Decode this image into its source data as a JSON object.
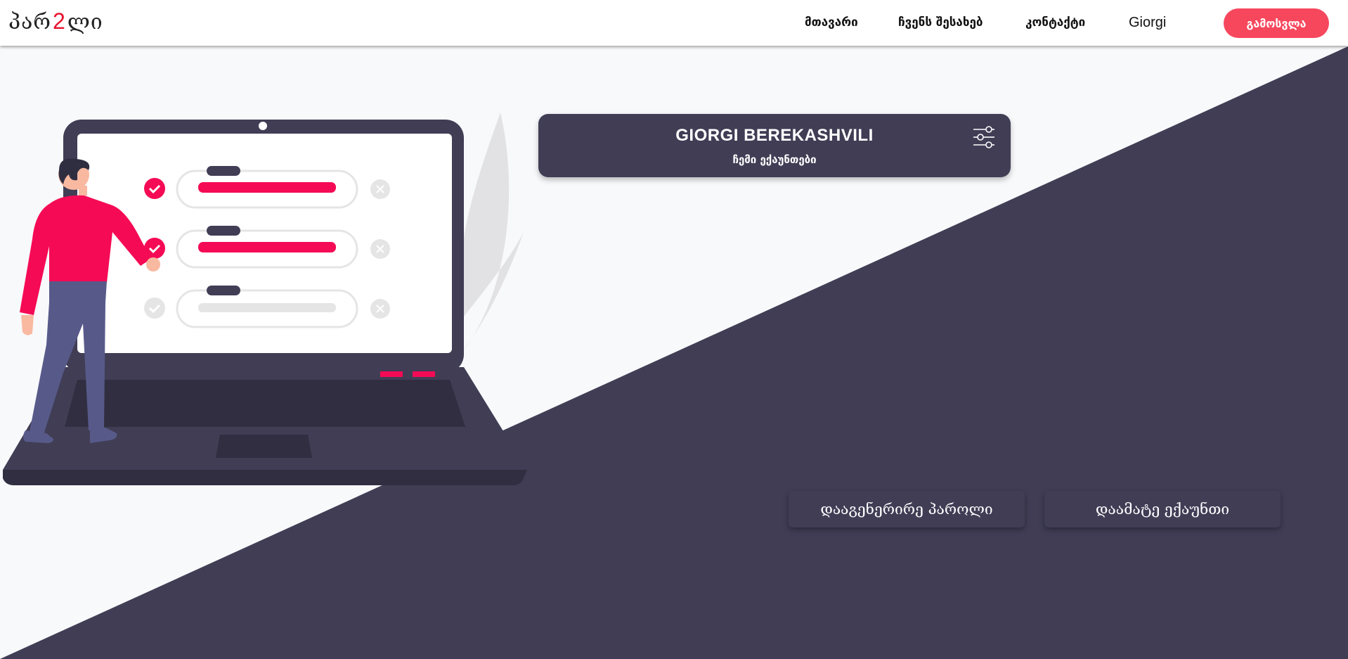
{
  "brand": {
    "logo_prefix": "პარ",
    "logo_number": "2",
    "logo_suffix": "ლი"
  },
  "nav": {
    "links": [
      {
        "label": "მთავარი"
      },
      {
        "label": "ჩვენს შესახებ"
      },
      {
        "label": "კონტაქტი"
      },
      {
        "label": "Giorgi"
      }
    ],
    "logout_label": "გამოსვლა"
  },
  "account_card": {
    "name": "GIORGI BEREKASHVILI",
    "subtitle": "ჩემი ექაუნთები",
    "icon": "sliders-icon"
  },
  "actions": {
    "generate_password_label": "დააგენერირე პაროლი",
    "add_account_label": "დაამატე ექაუნთი"
  },
  "colors": {
    "accent": "#f6475d",
    "dark": "#403d55",
    "logo_red": "#e8112d",
    "illustration_pink": "#f50a55",
    "background": "#f8f9fb"
  }
}
